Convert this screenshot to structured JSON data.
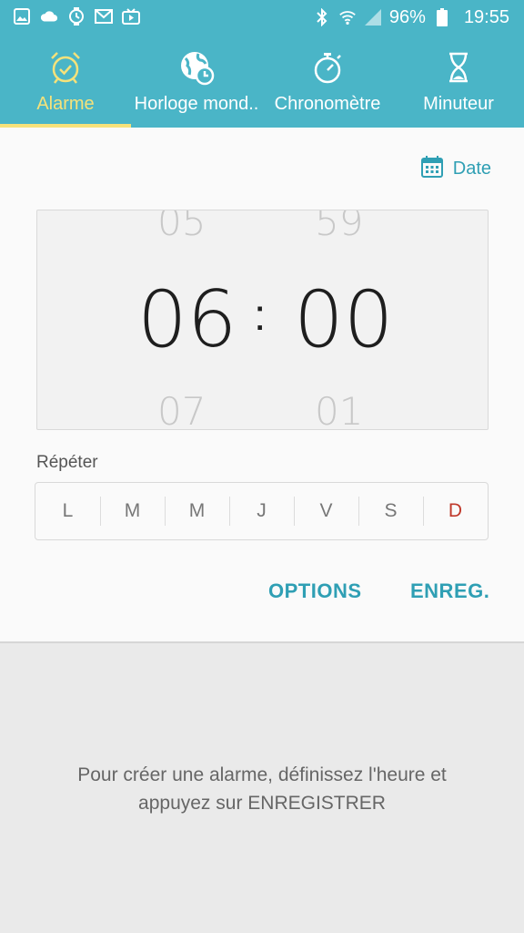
{
  "status_bar": {
    "battery": "96%",
    "time": "19:55",
    "left_icons": [
      "gallery-icon",
      "cloud-icon",
      "watch-icon",
      "mail-icon",
      "video-icon"
    ],
    "right_icons": [
      "bluetooth-icon",
      "wifi-icon",
      "signal-icon",
      "battery-icon"
    ]
  },
  "tabs": [
    {
      "label": "Alarme",
      "icon": "alarm-clock-icon",
      "active": true
    },
    {
      "label": "Horloge mond..",
      "icon": "world-clock-icon",
      "active": false
    },
    {
      "label": "Chronomètre",
      "icon": "stopwatch-icon",
      "active": false
    },
    {
      "label": "Minuteur",
      "icon": "hourglass-icon",
      "active": false
    }
  ],
  "date_button": {
    "label": "Date",
    "icon": "calendar-icon"
  },
  "time_picker": {
    "hour": "06",
    "minute": "00",
    "hour_prev": "05",
    "hour_next": "07",
    "minute_prev": "59",
    "minute_next": "01",
    "separator": ":"
  },
  "repeat": {
    "label": "Répéter",
    "days": [
      "L",
      "M",
      "M",
      "J",
      "V",
      "S",
      "D"
    ]
  },
  "actions": {
    "options": "OPTIONS",
    "save": "ENREG."
  },
  "hint": {
    "line1": "Pour créer une alarme, définissez l'heure et",
    "line2": "appuyez sur ENREGISTRER"
  },
  "colors": {
    "accent": "#4ab5c7",
    "active_tab": "#f6e27a",
    "action_text": "#2f9fb4",
    "sunday": "#c0392b"
  }
}
